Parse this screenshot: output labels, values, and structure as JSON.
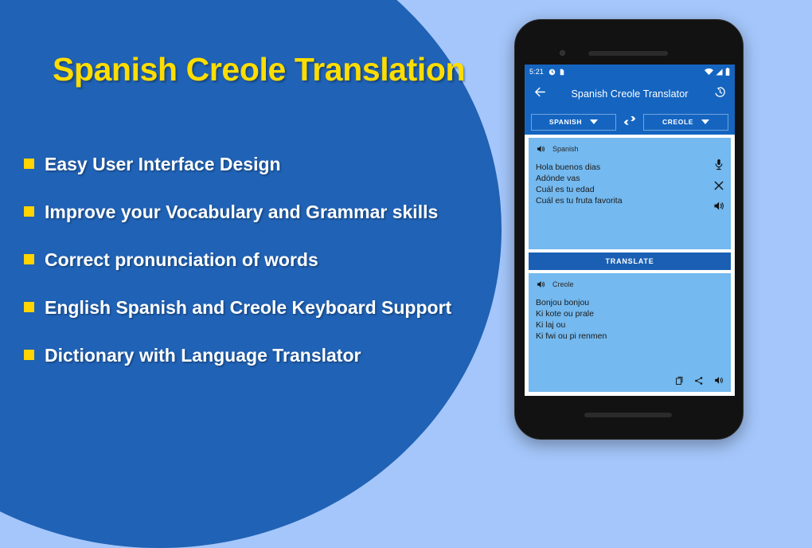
{
  "promo": {
    "title": "Spanish Creole Translation",
    "features": [
      "Easy User Interface Design",
      "Improve your Vocabulary and Grammar skills",
      "Correct pronunciation of words",
      "English Spanish and Creole Keyboard Support",
      " Dictionary with Language Translator"
    ],
    "colors": {
      "background": "#a4c6fa",
      "circle": "#2062b5",
      "title": "#ffdd00",
      "bullet": "#ffd400",
      "feature_text": "#ffffff"
    }
  },
  "phone": {
    "status_bar": {
      "time": "5:21",
      "left_icons": [
        "clock-icon",
        "sd-card-icon"
      ],
      "right_icons": [
        "wifi-icon",
        "signal-icon",
        "battery-icon"
      ]
    },
    "app_bar": {
      "back_icon": "back-arrow-icon",
      "title": "Spanish Creole Translator",
      "history_icon": "history-icon"
    },
    "language_bar": {
      "source": "SPANISH",
      "target": "CREOLE",
      "swap_icon": "swap-arrows-icon"
    },
    "source_card": {
      "speaker_icon": "speaker-icon",
      "language_label": "Spanish",
      "text": "Hola buenos dias\nAdónde vas\nCuál es tu edad\nCuál es tu fruta favorita",
      "actions": [
        "mic-icon",
        "clear-icon",
        "speaker-icon"
      ]
    },
    "translate_button": {
      "label": "TRANSLATE"
    },
    "result_card": {
      "speaker_icon": "speaker-icon",
      "language_label": "Creole",
      "text": "Bonjou bonjou\nKi kote ou prale\nKi laj ou\nKi fwi ou pi renmen",
      "actions": [
        "copy-icon",
        "share-icon",
        "speaker-icon"
      ]
    },
    "colors": {
      "app_bar": "#1565c0",
      "card": "#74b9ef",
      "translate_button": "#1a5fb4",
      "frame": "#121212"
    }
  }
}
